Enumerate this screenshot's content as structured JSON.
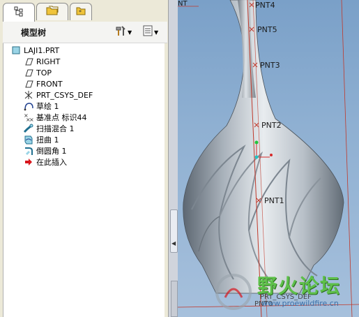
{
  "tabs": [
    {
      "name": "model-tree-tab-icon"
    },
    {
      "name": "folder-browser-tab-icon"
    },
    {
      "name": "favorites-tab-icon"
    }
  ],
  "panel": {
    "title": "模型树"
  },
  "tree": {
    "items": [
      {
        "label": "LAJI1.PRT",
        "icon": "part-icon"
      },
      {
        "label": "RIGHT",
        "icon": "datum-plane-icon"
      },
      {
        "label": "TOP",
        "icon": "datum-plane-icon"
      },
      {
        "label": "FRONT",
        "icon": "datum-plane-icon"
      },
      {
        "label": "PRT_CSYS_DEF",
        "icon": "csys-icon"
      },
      {
        "label": "草绘 1",
        "icon": "sketch-icon"
      },
      {
        "label": "基准点 标识44",
        "icon": "datum-point-icon"
      },
      {
        "label": "扫描混合 1",
        "icon": "swept-blend-icon"
      },
      {
        "label": "扭曲 1",
        "icon": "warp-icon"
      },
      {
        "label": "倒圆角 1",
        "icon": "round-icon"
      },
      {
        "label": "在此插入",
        "icon": "insert-here-arrow-icon"
      }
    ]
  },
  "viewport": {
    "points": [
      "PNT4",
      "PNT5",
      "PNT3",
      "PNT2",
      "PNT1"
    ],
    "corner_label": "NT",
    "csys_label": "PRT_CSYS_DEF",
    "bottom_label": "PNT0",
    "watermark": {
      "title": "野火论坛",
      "url": "www.proewildfire.cn"
    }
  },
  "colors": {
    "datum": "#c0392b",
    "accent": "#1f3f8f",
    "insert_arrow": "#d8161c"
  }
}
